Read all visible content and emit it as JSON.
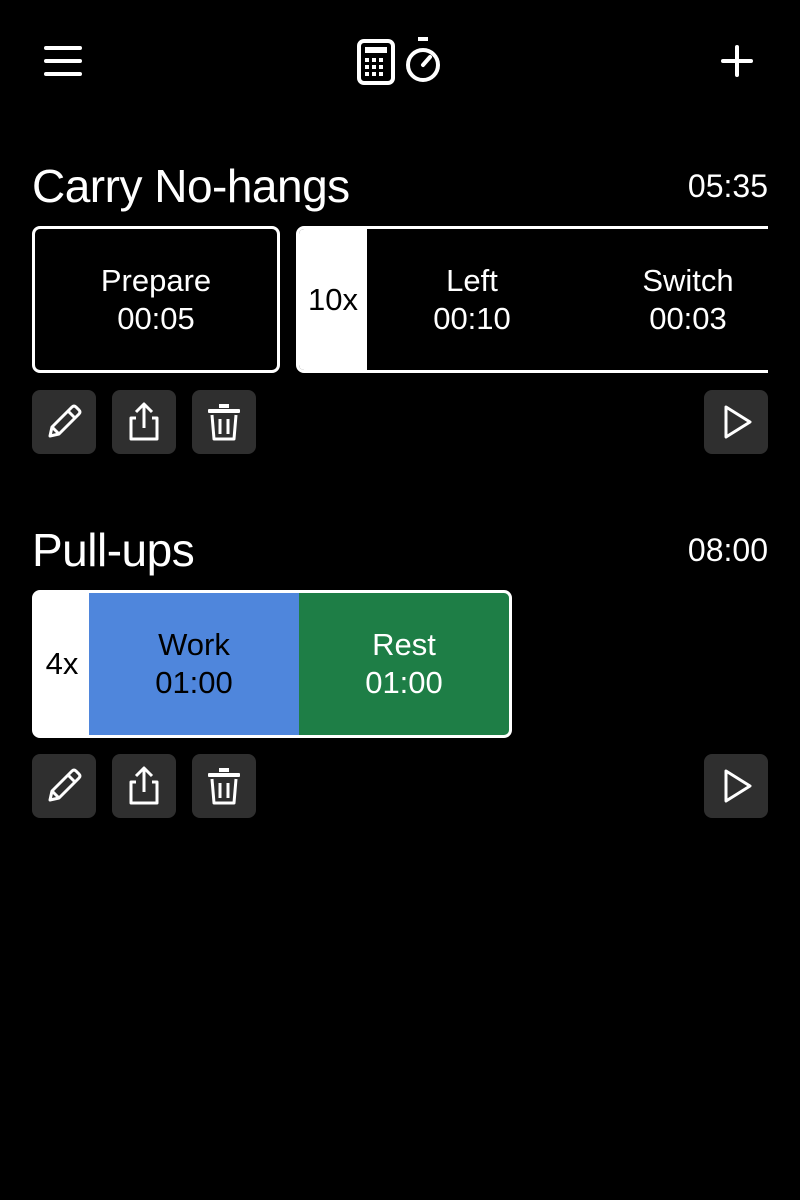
{
  "header": {
    "menu_icon": "hamburger-menu-icon",
    "logo_icons": [
      "calculator-icon",
      "stopwatch-icon"
    ],
    "add_icon": "plus-icon"
  },
  "workouts": [
    {
      "title": "Carry No-hangs",
      "total_duration": "05:35",
      "prepare": {
        "label": "Prepare",
        "time": "00:05"
      },
      "repeat": {
        "count": "10x",
        "segments": [
          {
            "label": "Left",
            "time": "00:10"
          },
          {
            "label": "Switch",
            "time": "00:03"
          }
        ]
      },
      "scroll_progress": 0.62
    },
    {
      "title": "Pull-ups",
      "total_duration": "08:00",
      "repeat": {
        "count": "4x",
        "segments": [
          {
            "label": "Work",
            "time": "01:00",
            "color": "#4f86dc"
          },
          {
            "label": "Rest",
            "time": "01:00",
            "color": "#1e7e46"
          }
        ]
      }
    }
  ],
  "actions": {
    "edit_icon": "pencil-icon",
    "share_icon": "share-icon",
    "delete_icon": "trash-icon",
    "play_icon": "play-icon"
  },
  "colors": {
    "background": "#000000",
    "button_bg": "#2f2f2f",
    "work": "#4f86dc",
    "rest": "#1e7e46",
    "progress": "#8a8a8a"
  }
}
